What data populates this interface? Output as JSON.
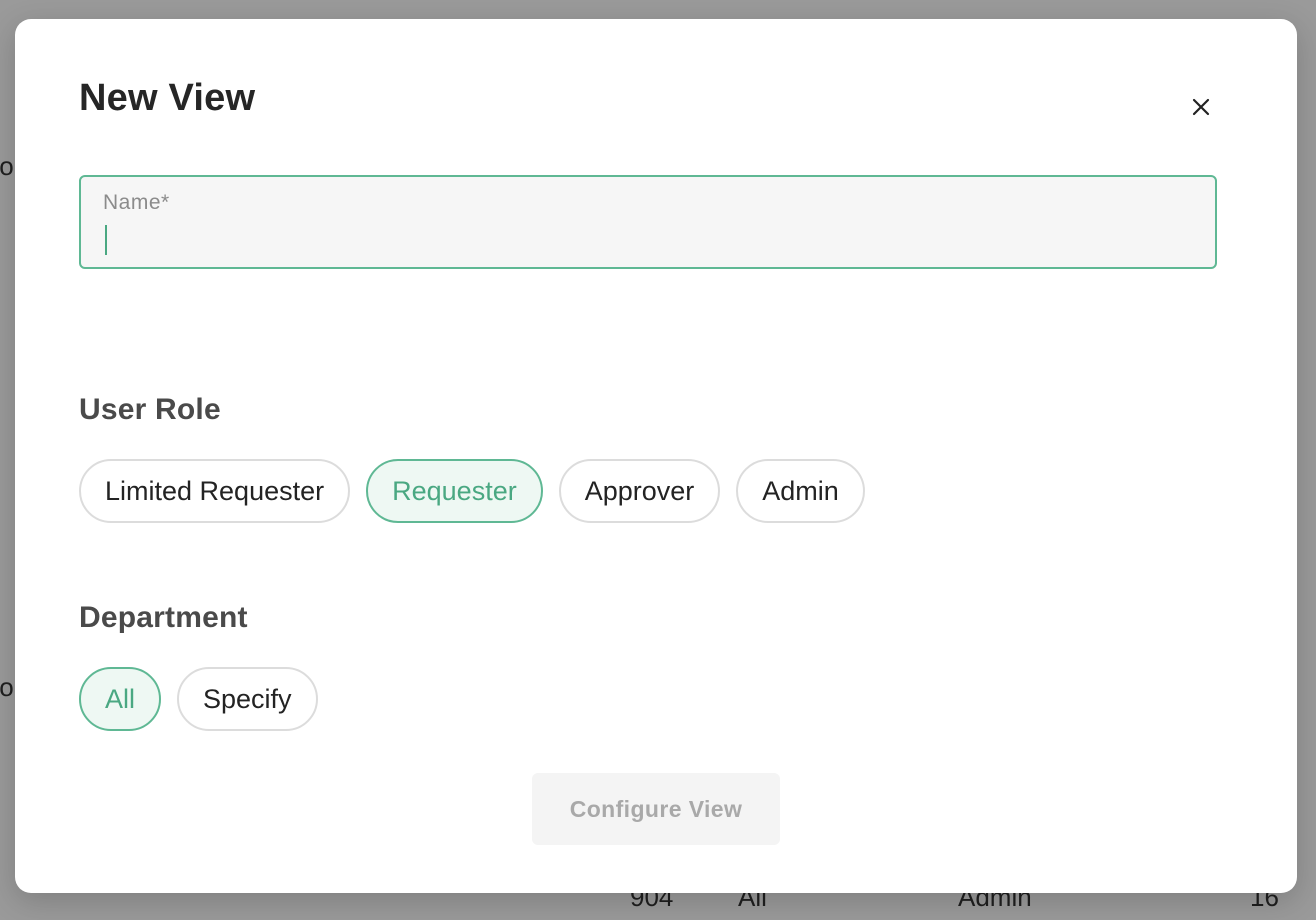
{
  "background": {
    "fragment_top": "fo",
    "fragment_mid": "fo",
    "row": [
      "904",
      "All",
      "Admin",
      "16"
    ]
  },
  "modal": {
    "title": "New View",
    "close_icon": "close-icon",
    "name_field": {
      "label": "Name*",
      "value": ""
    },
    "user_role": {
      "heading": "User Role",
      "options": [
        "Limited Requester",
        "Requester",
        "Approver",
        "Admin"
      ],
      "selected": "Requester"
    },
    "department": {
      "heading": "Department",
      "options": [
        "All",
        "Specify"
      ],
      "selected": "All"
    },
    "configure_button": "Configure View"
  },
  "colors": {
    "accent": "#5fb894",
    "accent_text": "#4aa882",
    "chip_selected_bg": "#eef8f3",
    "overlay": "#9a9a9a"
  }
}
